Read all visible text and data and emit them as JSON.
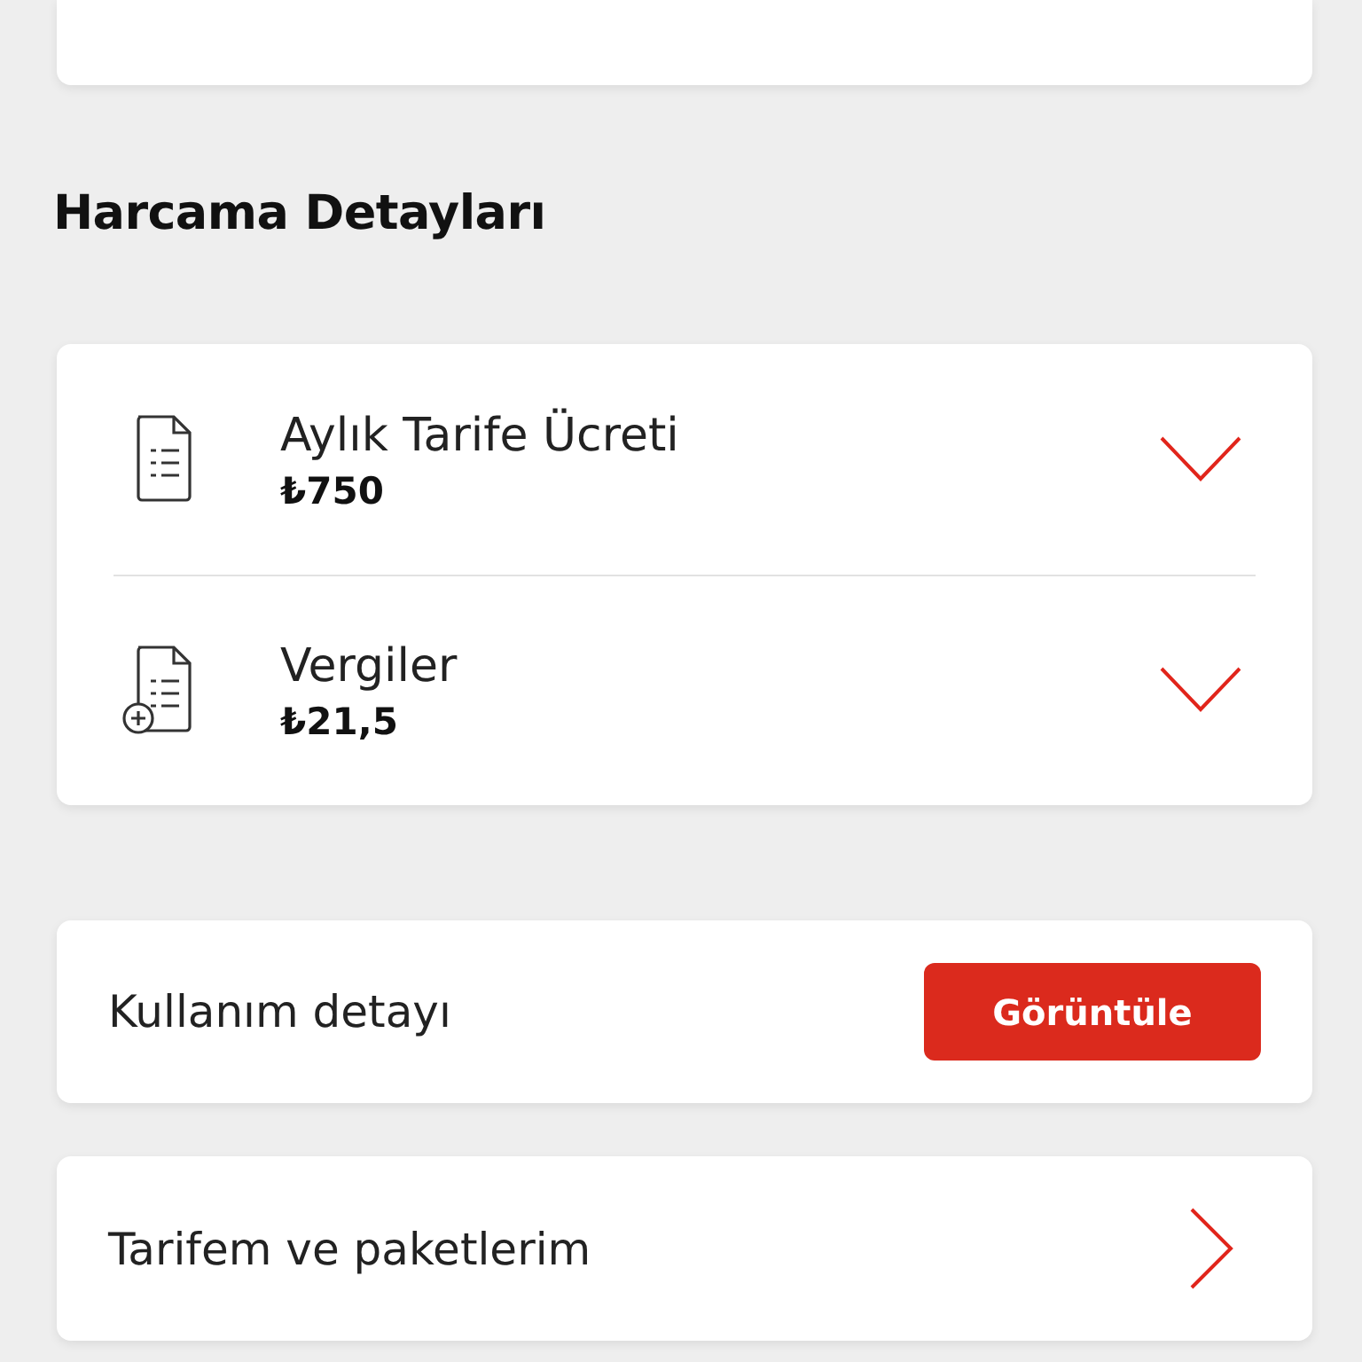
{
  "section_title": "Harcama Detayları",
  "charges": [
    {
      "kind": "tariff",
      "title": "Aylık Tarife Ücreti",
      "amount": "₺750",
      "expanded": false
    },
    {
      "kind": "tax",
      "title": "Vergiler",
      "amount": "₺21,5",
      "expanded": false
    }
  ],
  "usage": {
    "label": "Kullanım detayı",
    "button": "Görüntüle"
  },
  "plans": {
    "label": "Tarifem ve paketlerim"
  }
}
